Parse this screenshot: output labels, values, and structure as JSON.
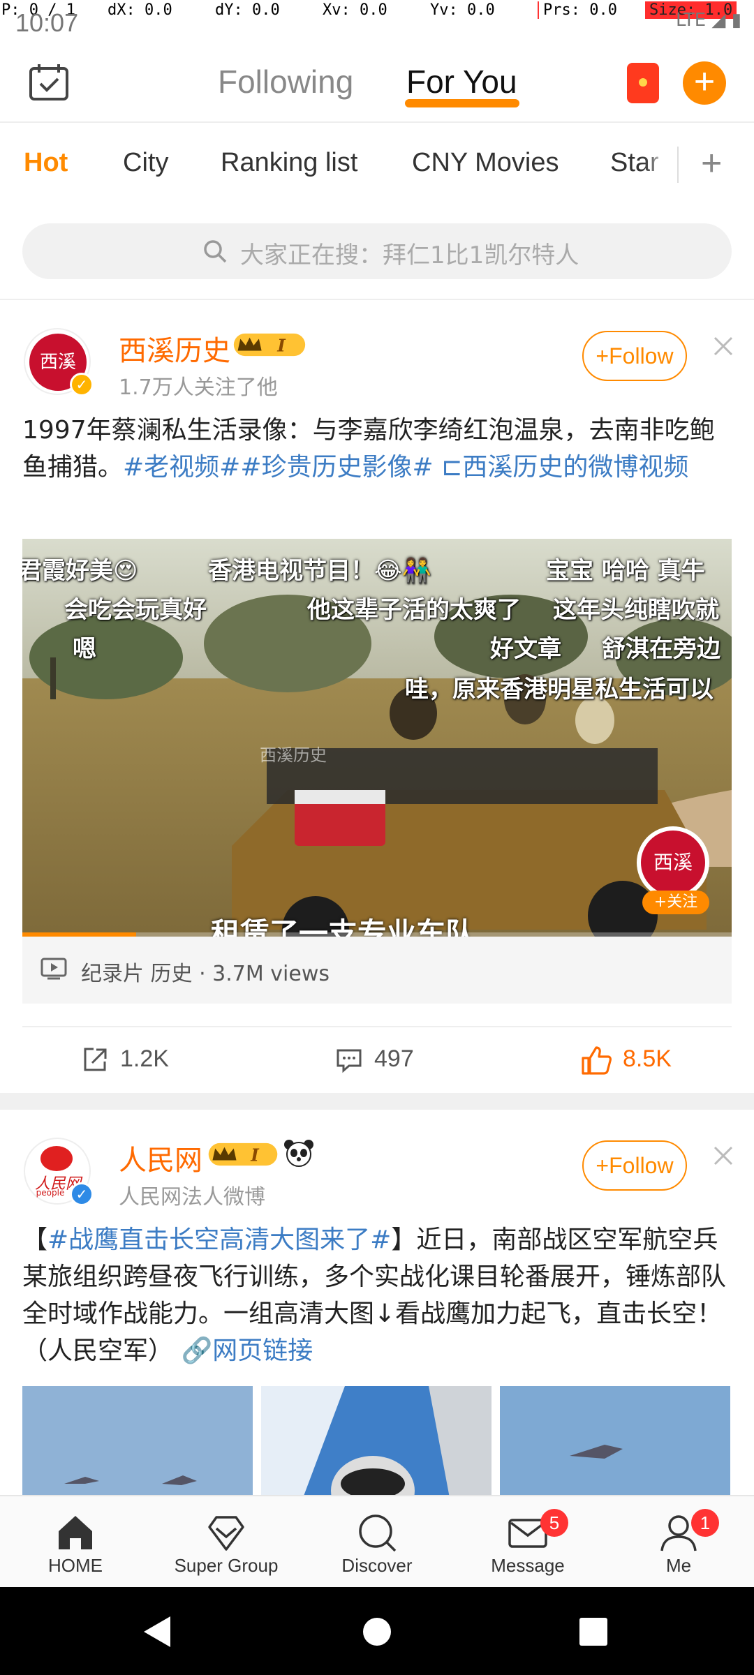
{
  "debug": {
    "p": "P: 0 / 1",
    "dx": "dX: 0.0",
    "dy": "dY: 0.0",
    "xv": "Xv: 0.0",
    "yv": "Yv: 0.0",
    "prs": "Prs: 0.0",
    "size": "Size: 1.0"
  },
  "status": {
    "time": "10:07",
    "network": "LTE"
  },
  "header": {
    "tabs": [
      {
        "label": "Following",
        "active": false
      },
      {
        "label": "For You",
        "active": true
      }
    ],
    "accent": "#ff8a00"
  },
  "categories": [
    {
      "label": "Hot",
      "active": true
    },
    {
      "label": "City",
      "active": false
    },
    {
      "label": "Ranking list",
      "active": false
    },
    {
      "label": "CNY Movies",
      "active": false
    },
    {
      "label": "Star",
      "active": false
    }
  ],
  "search": {
    "placeholder": "大家正在搜：拜仁1比1凯尔特人"
  },
  "post1": {
    "author": "西溪历史",
    "avatar_text": "西溪",
    "level": "I",
    "subtitle": "1.7万人关注了他",
    "follow_label": "Follow",
    "text": "1997年蔡澜私生活录像：与李嘉欣李绮红泡温泉，去南非吃鲍鱼捕猎。",
    "tags": "#老视频##珍贵历史影像#",
    "video_link": "西溪历史的微博视频",
    "danmu": [
      "君霞好美😍",
      "香港电视节目！😂👫",
      "宝宝 哈哈 真牛",
      "会吃会玩真好",
      "他这辈子活的太爽了",
      "这年头纯瞎吹就",
      "嗯",
      "好文章",
      "舒淇在旁边",
      "哇，原来香港明星私生活可以"
    ],
    "video_watermark": "西溪历史",
    "video_subtitle": "租赁了一支专业车队",
    "video_logo_text": "西溪",
    "video_follow": "+关注",
    "video_progress": 0.16,
    "meta": "纪录片 历史 · 3.7M views",
    "shares": "1.2K",
    "comments": "497",
    "likes": "8.5K"
  },
  "post2": {
    "author": "人民网",
    "avatar_text": "人民网",
    "avatar_sub": "people",
    "level": "I",
    "subtitle": "人民网法人微博",
    "follow_label": "Follow",
    "text_open": "【",
    "tag": "#战鹰直击长空高清大图来了#",
    "text_rest": "】近日，南部战区空军航空兵某旅组织跨昼夜飞行训练，多个实战化课目轮番展开，锤炼部队全时域作战能力。一组高清大图↓看战鹰加力起飞，直击长空！（人民空军）",
    "link": "网页链接"
  },
  "bottom_nav": [
    {
      "label": "HOME",
      "icon": "home-icon"
    },
    {
      "label": "Super Group",
      "icon": "diamond-icon"
    },
    {
      "label": "Discover",
      "icon": "discover-icon"
    },
    {
      "label": "Message",
      "icon": "mail-icon",
      "badge": "5"
    },
    {
      "label": "Me",
      "icon": "person-icon",
      "badge": "1"
    }
  ]
}
